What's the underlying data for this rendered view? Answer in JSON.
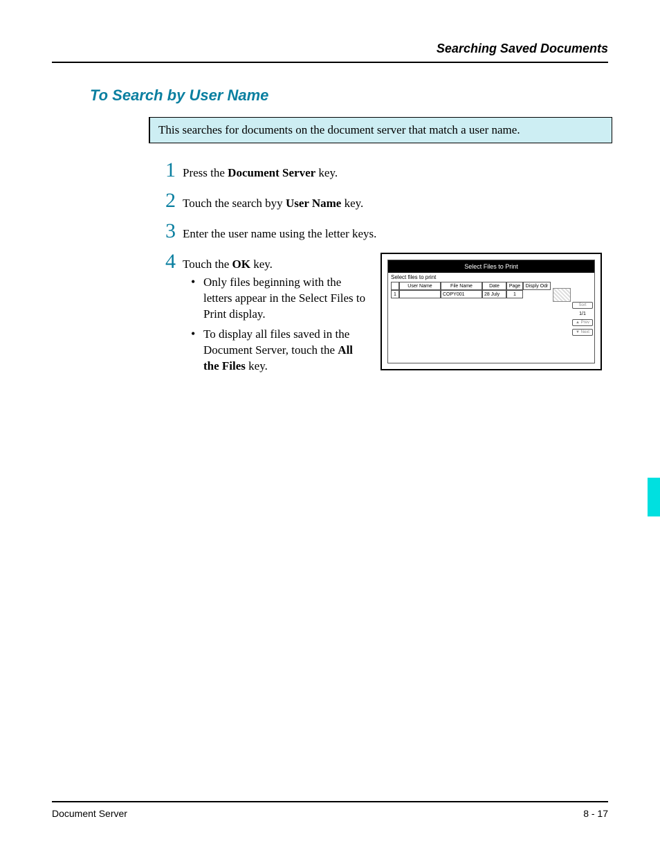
{
  "header": {
    "title": "Searching Saved Documents"
  },
  "section": {
    "title": "To Search by User Name",
    "intro": "This searches for documents on the document server that match a user name."
  },
  "steps": {
    "s1": {
      "num": "1",
      "pre": "Press the ",
      "bold": "Document Server",
      "post": " key."
    },
    "s2": {
      "num": "2",
      "pre": "Touch the search byy ",
      "bold": "User Name",
      "post": " key."
    },
    "s3": {
      "num": "3",
      "text": "Enter the user name using the letter keys."
    },
    "s4": {
      "num": "4",
      "pre": "Touch the ",
      "bold": "OK",
      "post": " key."
    },
    "bullets": {
      "b1": "Only files beginning with the letters appear in the Select Files to Print display.",
      "b2_pre": "To display all files saved in the Document Server, touch the ",
      "b2_bold": "All the Files",
      "b2_post": " key."
    }
  },
  "figure": {
    "title": "Select Files to Print",
    "subtitle": "Select files to print",
    "headers": {
      "user": "User Name",
      "file": "File Name",
      "date": "Date",
      "page": "Page",
      "order": "Disply Odr"
    },
    "row": {
      "idx": "1",
      "file": "COPY001",
      "date": "28 July",
      "page": "1"
    },
    "side": {
      "sort": "Sort",
      "pages": "1/1",
      "prev": "▲ Prev",
      "next": "▼ Next"
    }
  },
  "footer": {
    "left": "Document Server",
    "right": "8 - 17"
  }
}
